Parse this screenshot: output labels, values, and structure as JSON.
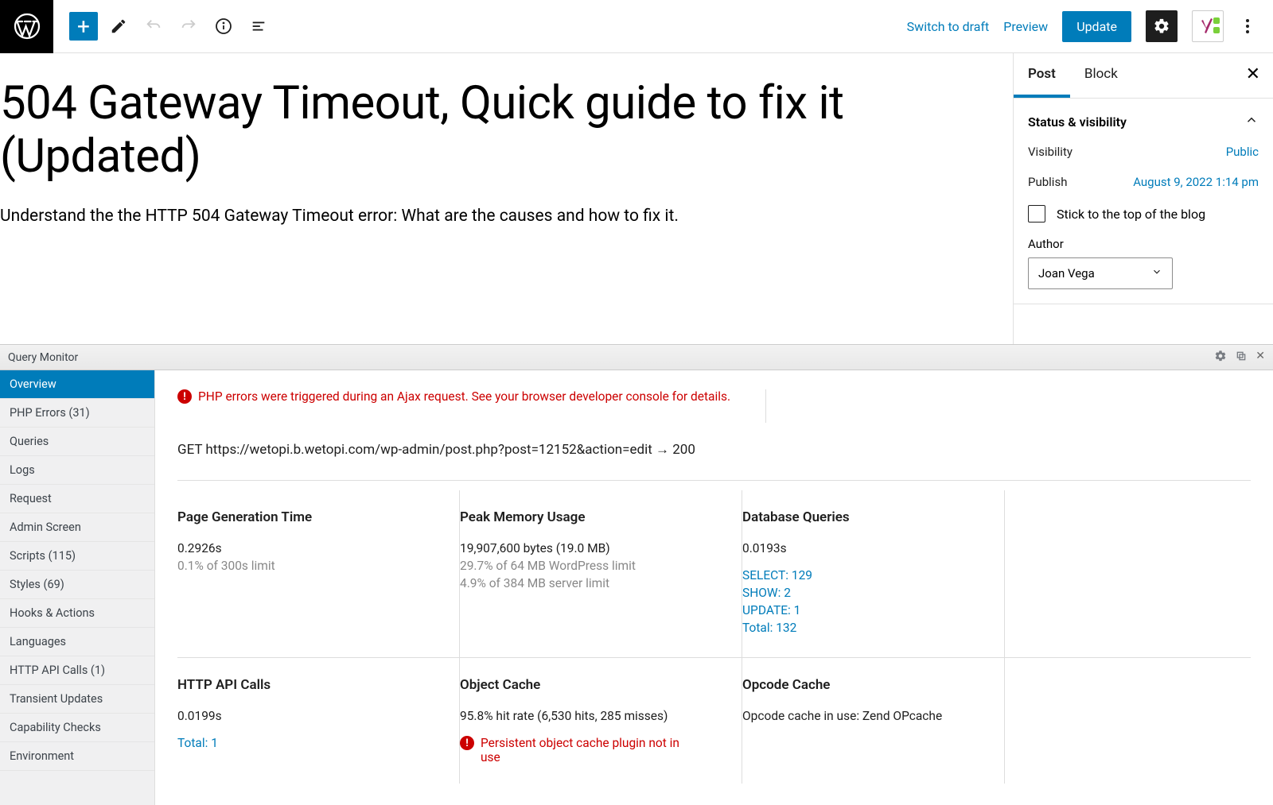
{
  "topbar": {
    "switch_draft": "Switch to draft",
    "preview": "Preview",
    "update": "Update"
  },
  "post": {
    "title": "504 Gateway Timeout, Quick guide to fix it (Updated)",
    "excerpt": "Understand the the HTTP 504 Gateway Timeout error: What are the causes and how to fix it."
  },
  "sidebar": {
    "tabs": {
      "post": "Post",
      "block": "Block"
    },
    "panel_title": "Status & visibility",
    "visibility_label": "Visibility",
    "visibility_value": "Public",
    "publish_label": "Publish",
    "publish_value": "August 9, 2022 1:14 pm",
    "sticky_label": "Stick to the top of the blog",
    "author_label": "Author",
    "author_value": "Joan Vega"
  },
  "qm": {
    "title": "Query Monitor",
    "nav": [
      "Overview",
      "PHP Errors (31)",
      "Queries",
      "Logs",
      "Request",
      "Admin Screen",
      "Scripts (115)",
      "Styles (69)",
      "Hooks & Actions",
      "Languages",
      "HTTP API Calls (1)",
      "Transient Updates",
      "Capability Checks",
      "Environment"
    ],
    "alert": "PHP errors were triggered during an Ajax request. See your browser developer console for details.",
    "url": "GET https://wetopi.b.wetopi.com/wp-admin/post.php?post=12152&action=edit → 200",
    "cards": {
      "pgt": {
        "title": "Page Generation Time",
        "val": "0.2926s",
        "sub": "0.1% of 300s limit"
      },
      "mem": {
        "title": "Peak Memory Usage",
        "val": "19,907,600 bytes (19.0 MB)",
        "sub1": "29.7% of 64 MB WordPress limit",
        "sub2": "4.9% of 384 MB server limit"
      },
      "db": {
        "title": "Database Queries",
        "val": "0.0193s",
        "select": "SELECT: 129",
        "show": "SHOW: 2",
        "update": "UPDATE: 1",
        "total": "Total: 132"
      },
      "http": {
        "title": "HTTP API Calls",
        "val": "0.0199s",
        "total": "Total: 1"
      },
      "obj": {
        "title": "Object Cache",
        "val": "95.8% hit rate (6,530 hits, 285 misses)",
        "err": "Persistent object cache plugin not in use"
      },
      "op": {
        "title": "Opcode Cache",
        "val": "Opcode cache in use: Zend OPcache"
      }
    }
  }
}
